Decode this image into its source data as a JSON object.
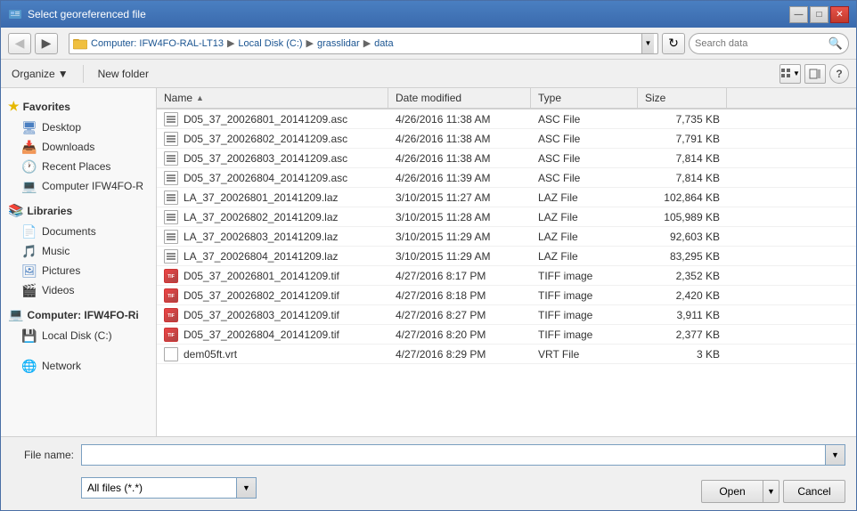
{
  "window": {
    "title": "Select georeferenced file"
  },
  "titlebar": {
    "minimize_label": "—",
    "maximize_label": "□",
    "close_label": "✕"
  },
  "toolbar": {
    "back_btn": "◀",
    "forward_btn": "▶",
    "address_parts": [
      "Computer: IFW4FO-RAL-LT13",
      "Local Disk (C:)",
      "grasslidar",
      "data"
    ],
    "refresh_label": "↻",
    "search_placeholder": "Search data"
  },
  "toolbar2": {
    "organize_label": "Organize",
    "new_folder_label": "New folder",
    "help_label": "?"
  },
  "sidebar": {
    "favorites_label": "Favorites",
    "favorites_items": [
      {
        "name": "Desktop",
        "icon": "desktop"
      },
      {
        "name": "Downloads",
        "icon": "downloads"
      },
      {
        "name": "Recent Places",
        "icon": "recent"
      },
      {
        "name": "Computer IFW4FO-R",
        "icon": "computer"
      }
    ],
    "libraries_label": "Libraries",
    "libraries_items": [
      {
        "name": "Documents",
        "icon": "docs"
      },
      {
        "name": "Music",
        "icon": "music"
      },
      {
        "name": "Pictures",
        "icon": "pics"
      },
      {
        "name": "Videos",
        "icon": "videos"
      }
    ],
    "computer_label": "Computer: IFW4FO-Ri",
    "computer_items": [
      {
        "name": "Local Disk (C:)",
        "icon": "disk"
      }
    ],
    "network_items": [
      {
        "name": "Network",
        "icon": "network"
      }
    ]
  },
  "file_list": {
    "columns": [
      "Name",
      "Date modified",
      "Type",
      "Size"
    ],
    "files": [
      {
        "name": "D05_37_20026801_20141209.asc",
        "date": "4/26/2016 11:38 AM",
        "type": "ASC File",
        "size": "7,735 KB",
        "icon": "asc"
      },
      {
        "name": "D05_37_20026802_20141209.asc",
        "date": "4/26/2016 11:38 AM",
        "type": "ASC File",
        "size": "7,791 KB",
        "icon": "asc"
      },
      {
        "name": "D05_37_20026803_20141209.asc",
        "date": "4/26/2016 11:38 AM",
        "type": "ASC File",
        "size": "7,814 KB",
        "icon": "asc"
      },
      {
        "name": "D05_37_20026804_20141209.asc",
        "date": "4/26/2016 11:39 AM",
        "type": "ASC File",
        "size": "7,814 KB",
        "icon": "asc"
      },
      {
        "name": "LA_37_20026801_20141209.laz",
        "date": "3/10/2015 11:27 AM",
        "type": "LAZ File",
        "size": "102,864 KB",
        "icon": "laz"
      },
      {
        "name": "LA_37_20026802_20141209.laz",
        "date": "3/10/2015 11:28 AM",
        "type": "LAZ File",
        "size": "105,989 KB",
        "icon": "laz"
      },
      {
        "name": "LA_37_20026803_20141209.laz",
        "date": "3/10/2015 11:29 AM",
        "type": "LAZ File",
        "size": "92,603 KB",
        "icon": "laz"
      },
      {
        "name": "LA_37_20026804_20141209.laz",
        "date": "3/10/2015 11:29 AM",
        "type": "LAZ File",
        "size": "83,295 KB",
        "icon": "laz"
      },
      {
        "name": "D05_37_20026801_20141209.tif",
        "date": "4/27/2016 8:17 PM",
        "type": "TIFF image",
        "size": "2,352 KB",
        "icon": "tif"
      },
      {
        "name": "D05_37_20026802_20141209.tif",
        "date": "4/27/2016 8:18 PM",
        "type": "TIFF image",
        "size": "2,420 KB",
        "icon": "tif"
      },
      {
        "name": "D05_37_20026803_20141209.tif",
        "date": "4/27/2016 8:27 PM",
        "type": "TIFF image",
        "size": "3,911 KB",
        "icon": "tif"
      },
      {
        "name": "D05_37_20026804_20141209.tif",
        "date": "4/27/2016 8:20 PM",
        "type": "TIFF image",
        "size": "2,377 KB",
        "icon": "tif"
      },
      {
        "name": "dem05ft.vrt",
        "date": "4/27/2016 8:29 PM",
        "type": "VRT File",
        "size": "3 KB",
        "icon": "vrt"
      }
    ]
  },
  "bottom": {
    "filename_label": "File name:",
    "filename_value": "",
    "filetype_label": "All files (*.*)",
    "open_label": "Open",
    "cancel_label": "Cancel"
  }
}
